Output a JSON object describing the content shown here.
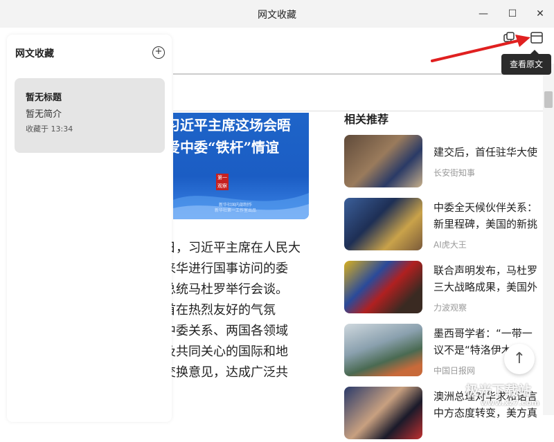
{
  "window": {
    "title": "网文收藏",
    "minimize_label": "—",
    "maximize_label": "☐",
    "close_label": "✕"
  },
  "sidebar": {
    "title": "网文收藏",
    "add_icon": "plus-circle-icon",
    "card": {
      "title": "暂无标题",
      "description": "暂无简介",
      "meta": "收藏于 13:34"
    }
  },
  "toolbar": {
    "copy_icon": "copy-icon",
    "view_original_icon": "window-icon",
    "tooltip": "查看原文"
  },
  "banner": {
    "line1": "习近平主席这场会晤",
    "line2": "爱中委“铁杆”情谊",
    "seal": "第一观察",
    "sub1": "新华社国内部制作",
    "sub2": "新华社第一工作室出品"
  },
  "article": {
    "lines": [
      "日，习近平主席在人民大",
      "来华进行国事访问的委",
      "总统马杜罗举行会谈。",
      "首在热烈友好的气氛",
      "中委关系、两国各领域",
      "及共同关心的国际和地",
      "交换意见，达成广泛共"
    ]
  },
  "related": {
    "title": "相关推荐",
    "items": [
      {
        "line1": "建交后，首任驻华大使",
        "line2": "",
        "source": "长安街知事"
      },
      {
        "line1": "中委全天候伙伴关系：",
        "line2": "新里程碑，美国的新挑",
        "source": "AI虎大王"
      },
      {
        "line1": "联合声明发布，马杜罗",
        "line2": "三大战略成果，美国外",
        "source": "力波观察"
      },
      {
        "line1": "墨西哥学者：“一带一",
        "line2": "议不是“特洛伊木马”",
        "source": "中国日报网"
      },
      {
        "line1": "澳洲总理对华求和语言",
        "line2": "中方态度转变，美方真",
        "source": ""
      }
    ]
  },
  "back_to_top_icon": "arrow-up-icon",
  "watermark": {
    "line1": "极光下载站",
    "line2": "www.xz7.com"
  }
}
